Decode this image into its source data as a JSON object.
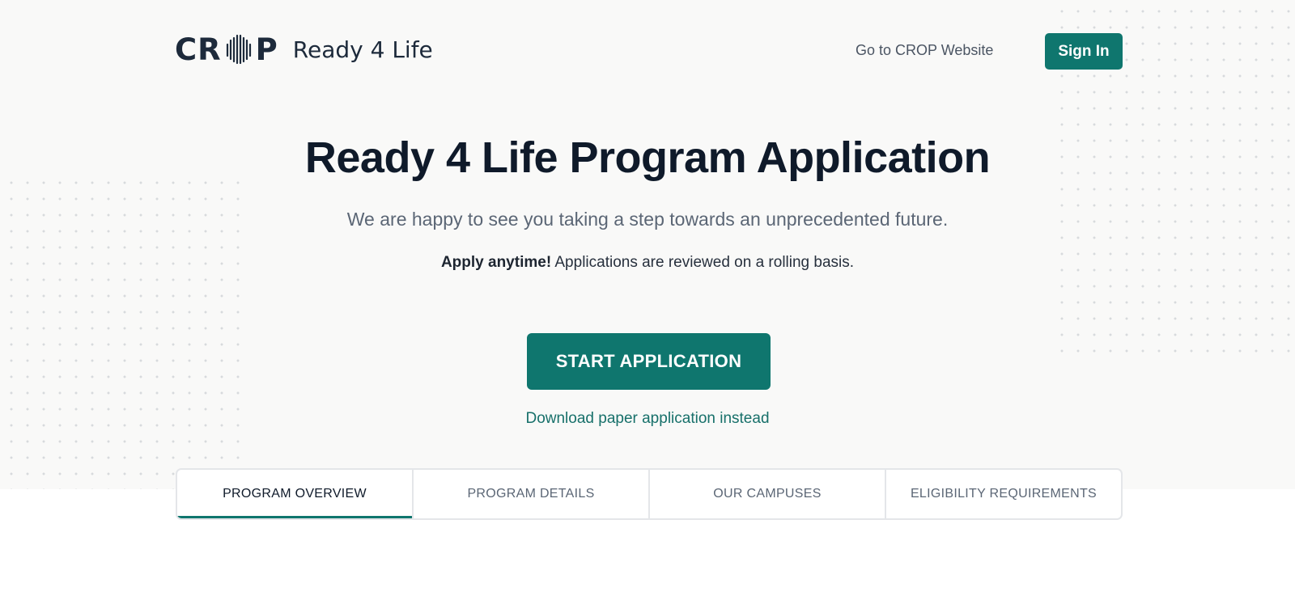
{
  "header": {
    "logo_brand": "CROP",
    "logo_app_name": "Ready 4 Life",
    "nav_link": "Go to CROP Website",
    "sign_in_label": "Sign In"
  },
  "hero": {
    "title": "Ready 4 Life Program Application",
    "subtitle": "We are happy to see you taking a step towards an unprecedented future.",
    "note_bold": "Apply anytime!",
    "note_text": " Applications are reviewed on a rolling basis.",
    "start_label": "START APPLICATION",
    "paper_link": "Download paper application instead"
  },
  "tabs": [
    {
      "label": "PROGRAM OVERVIEW",
      "active": true
    },
    {
      "label": "PROGRAM DETAILS",
      "active": false
    },
    {
      "label": "OUR CAMPUSES",
      "active": false
    },
    {
      "label": "ELIGIBILITY REQUIREMENTS",
      "active": false
    }
  ],
  "colors": {
    "accent": "#0f766e",
    "hero_bg": "#f9f9f8",
    "text_dark": "#0f1a2a",
    "text_muted": "#5b6675"
  }
}
